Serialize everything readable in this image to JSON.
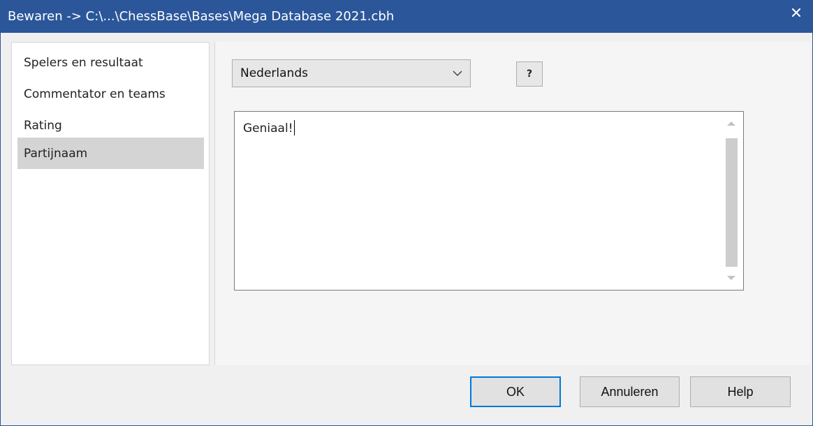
{
  "window": {
    "title": "Bewaren -> C:\\...\\ChessBase\\Bases\\Mega Database 2021.cbh",
    "close_icon": "close-icon",
    "titlebar_color": "#2b579a"
  },
  "nav": {
    "items": [
      {
        "label": "Spelers en resultaat",
        "selected": false
      },
      {
        "label": "Commentator en teams",
        "selected": false
      },
      {
        "label": "Rating",
        "selected": false
      },
      {
        "label": "Partijnaam",
        "selected": true
      }
    ]
  },
  "language_select": {
    "value": "Nederlands",
    "icon": "chevron-down-icon"
  },
  "help_button": {
    "label": "?"
  },
  "game_name_field": {
    "value": "Geniaal!"
  },
  "scrollbar": {
    "up_icon": "scroll-up-arrow-icon",
    "down_icon": "scroll-down-arrow-icon"
  },
  "buttons": {
    "ok": "OK",
    "cancel": "Annuleren",
    "help": "Help"
  }
}
